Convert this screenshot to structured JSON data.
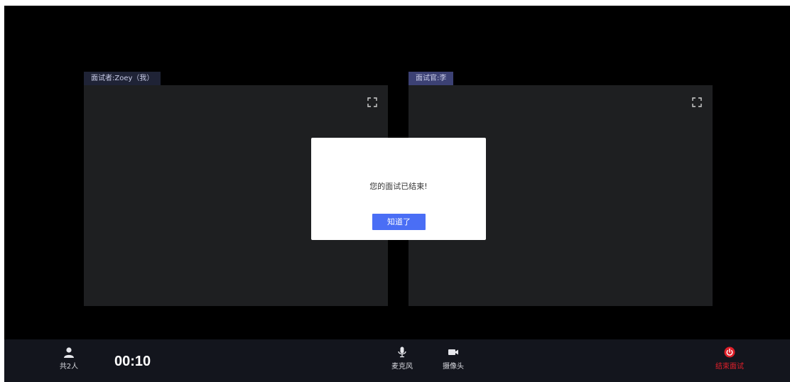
{
  "panels": [
    {
      "tag": "面试者:Zoey（我）",
      "tag_bg": "#1f2336"
    },
    {
      "tag": "面试官:李",
      "tag_bg": "#3c4174"
    }
  ],
  "modal": {
    "message": "您的面试已结束!",
    "button_label": "知道了",
    "button_color": "#4a6ef5"
  },
  "toolbar": {
    "participants_label": "共2人",
    "timer": "00:10",
    "mic_label": "麦克风",
    "camera_label": "摄像头",
    "end_label": "结束面试",
    "end_color": "#e0202a"
  },
  "icons": [
    "fullscreen-icon",
    "user-icon",
    "mic-icon",
    "camera-icon",
    "power-icon"
  ]
}
